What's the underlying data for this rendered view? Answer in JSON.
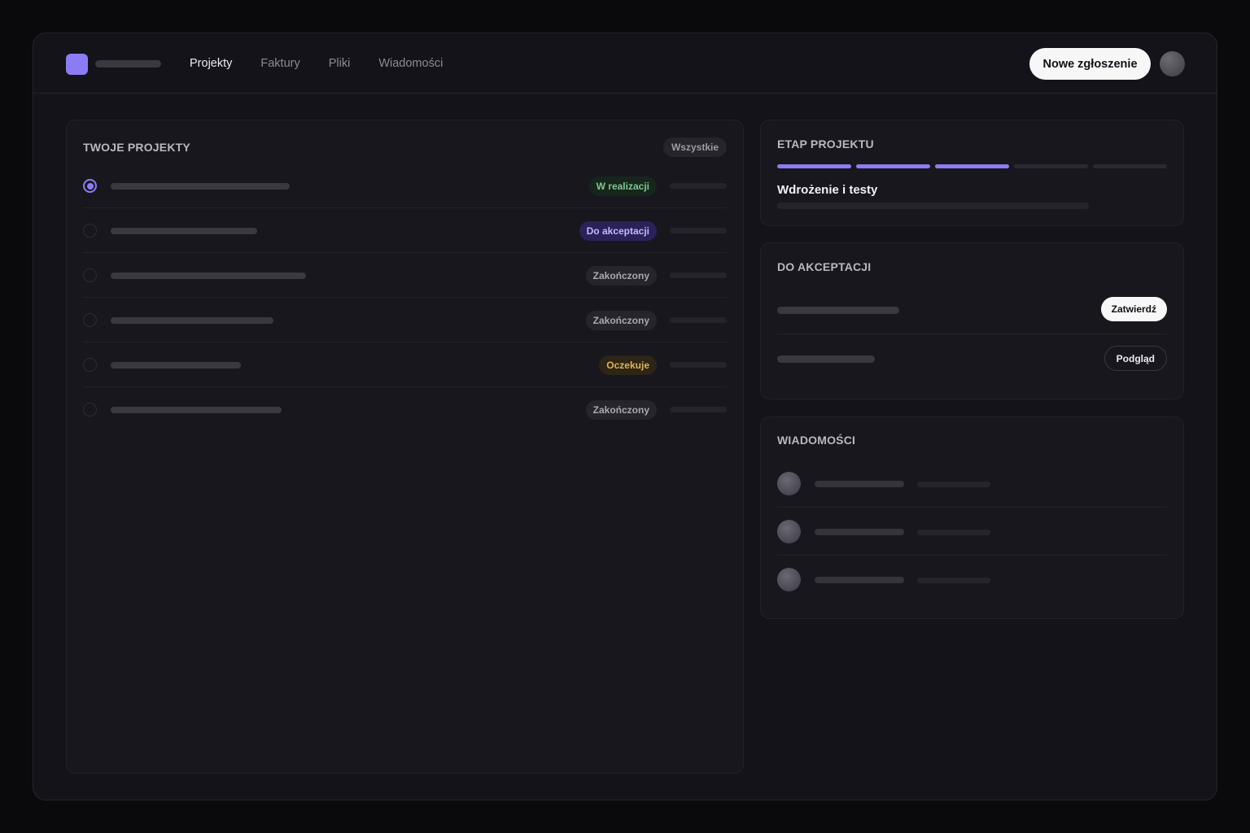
{
  "nav": {
    "items": [
      {
        "label": "Projekty",
        "active": true
      },
      {
        "label": "Faktury",
        "active": false
      },
      {
        "label": "Pliki",
        "active": false
      },
      {
        "label": "Wiadomości",
        "active": false
      }
    ],
    "new_button": "Nowe zgłoszenie"
  },
  "colors": {
    "accent": "#8b7cf6",
    "background": "#141319"
  },
  "projects": {
    "title": "TWOJE PROJEKTY",
    "filter": "Wszystkie",
    "rows": [
      {
        "status": "W realizacji",
        "variant": "green",
        "selected": true
      },
      {
        "status": "Do akceptacji",
        "variant": "purple",
        "selected": false
      },
      {
        "status": "Zakończony",
        "variant": "gray",
        "selected": false
      },
      {
        "status": "Zakończony",
        "variant": "gray",
        "selected": false
      },
      {
        "status": "Oczekuje",
        "variant": "amber",
        "selected": false
      },
      {
        "status": "Zakończony",
        "variant": "gray",
        "selected": false
      }
    ]
  },
  "stage": {
    "title": "ETAP PROJEKTU",
    "label": "Wdrożenie i testy",
    "completed_steps": 3,
    "total_steps": 5
  },
  "approvals": {
    "title": "DO AKCEPTACJI",
    "approve_button": "Zatwierdź",
    "preview_button": "Podgląd"
  },
  "messages": {
    "title": "WIADOMOŚCI"
  }
}
